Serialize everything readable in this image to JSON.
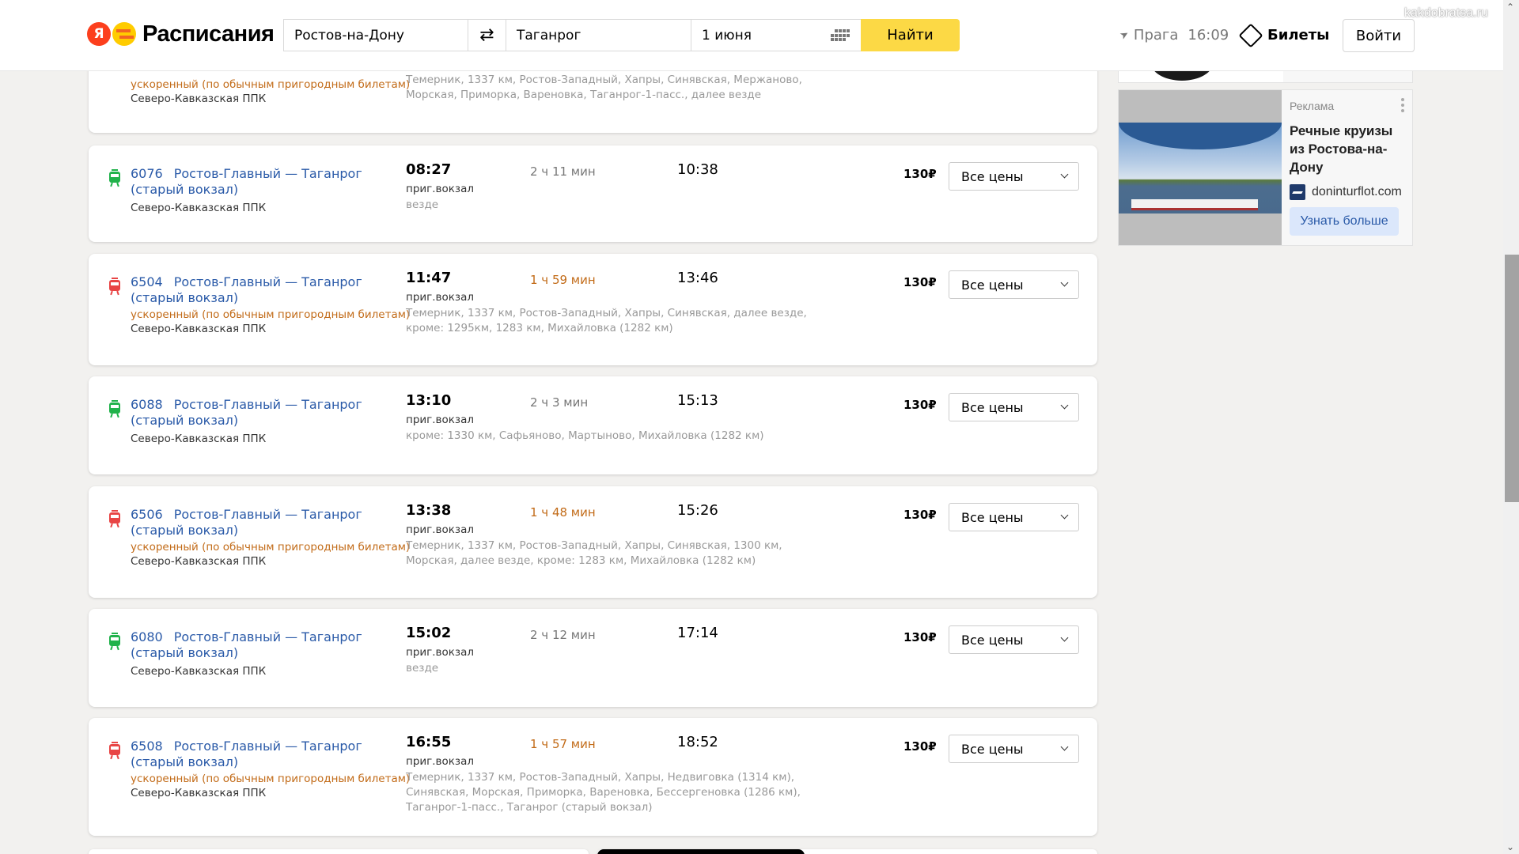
{
  "header": {
    "logo_letter": "Я",
    "logo_text": "Расписания",
    "search": {
      "from_value": "Ростов-на-Дону",
      "to_value": "Таганрог",
      "date_value": "1 июня",
      "swap_icon": "⇄",
      "find_label": "Найти"
    },
    "location": {
      "city": "Прага",
      "time": "16:09",
      "icon": "location-arrow-icon"
    },
    "tickets_label": "Билеты",
    "login_label": "Войти",
    "watermark": "kakdobratsa.ru"
  },
  "top_card": {
    "express": "ускоренный (по обычным пригородным билетам)",
    "carrier": "Северо-Кавказская ППК",
    "stops": "Темерник, 1337 км, Ростов-Западный, Хапры, Синявская, Мержаново, Морская, Приморка, Вареновка, Таганрог-1-пасс., далее везде"
  },
  "trains": [
    {
      "number": "6076",
      "route": "Ростов-Главный — Таганрог (старый вокзал)",
      "type_color": "green",
      "express": null,
      "carrier": "Северо-Кавказская ППК",
      "departure": "08:27",
      "duration": "2 ч 11 мин",
      "duration_fast": false,
      "arrival": "10:38",
      "station": "приг.вокзал",
      "stops": "везде",
      "price": "130₽",
      "select_label": "Все цены"
    },
    {
      "number": "6504",
      "route": "Ростов-Главный — Таганрог (старый вокзал)",
      "type_color": "red",
      "express": "ускоренный (по обычным пригородным билетам)",
      "carrier": "Северо-Кавказская ППК",
      "departure": "11:47",
      "duration": "1 ч 59 мин",
      "duration_fast": true,
      "arrival": "13:46",
      "station": "приг.вокзал",
      "stops": "Темерник, 1337 км, Ростов-Западный, Хапры, Синявская, далее везде, кроме: 1295км, 1283 км, Михайловка (1282 км)",
      "price": "130₽",
      "select_label": "Все цены"
    },
    {
      "number": "6088",
      "route": "Ростов-Главный — Таганрог (старый вокзал)",
      "type_color": "green",
      "express": null,
      "carrier": "Северо-Кавказская ППК",
      "departure": "13:10",
      "duration": "2 ч 3 мин",
      "duration_fast": false,
      "arrival": "15:13",
      "station": "приг.вокзал",
      "stops": "кроме: 1330 км, Сафьяново, Мартыново, Михайловка (1282 км)",
      "price": "130₽",
      "select_label": "Все цены"
    },
    {
      "number": "6506",
      "route": "Ростов-Главный — Таганрог (старый вокзал)",
      "type_color": "red",
      "express": "ускоренный (по обычным пригородным билетам)",
      "carrier": "Северо-Кавказская ППК",
      "departure": "13:38",
      "duration": "1 ч 48 мин",
      "duration_fast": true,
      "arrival": "15:26",
      "station": "приг.вокзал",
      "stops": "Темерник, 1337 км, Ростов-Западный, Хапры, Синявская, 1300 км, Морская, далее везде, кроме: 1283 км, Михайловка (1282 км)",
      "price": "130₽",
      "select_label": "Все цены"
    },
    {
      "number": "6080",
      "route": "Ростов-Главный — Таганрог (старый вокзал)",
      "type_color": "green",
      "express": null,
      "carrier": "Северо-Кавказская ППК",
      "departure": "15:02",
      "duration": "2 ч 12 мин",
      "duration_fast": false,
      "arrival": "17:14",
      "station": "приг.вокзал",
      "stops": "везде",
      "price": "130₽",
      "select_label": "Все цены"
    },
    {
      "number": "6508",
      "route": "Ростов-Главный — Таганрог (старый вокзал)",
      "type_color": "red",
      "express": "ускоренный (по обычным пригородным билетам)",
      "carrier": "Северо-Кавказская ППК",
      "departure": "16:55",
      "duration": "1 ч 57 мин",
      "duration_fast": true,
      "arrival": "18:52",
      "station": "приг.вокзал",
      "stops": "Темерник, 1337 км, Ростов-Западный, Хапры, Недвиговка (1314 км), Синявская, Морская, Приморка, Вареновка, Бессергеновка (1286 км), Таганрог-1-пасс., Таганрог (старый вокзал)",
      "price": "130₽",
      "select_label": "Все цены"
    }
  ],
  "ad": {
    "label": "Реклама",
    "title": "Речные круизы из Ростова-на-Дону",
    "domain": "doninturflot.com",
    "button_label": "Узнать больше"
  },
  "colors": {
    "accent_yellow": "#fcd945",
    "link_blue": "#2a5aa8",
    "express_orange": "#c26b18",
    "train_green": "#21b24b",
    "train_red": "#e84545"
  }
}
